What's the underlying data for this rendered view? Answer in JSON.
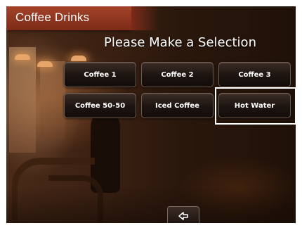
{
  "header": {
    "title": "Coffee Drinks"
  },
  "main": {
    "heading": "Please Make a Selection",
    "buttons": [
      {
        "label": "Coffee 1"
      },
      {
        "label": "Coffee 2"
      },
      {
        "label": "Coffee 3"
      },
      {
        "label": "Coffee 50-50"
      },
      {
        "label": "Iced Coffee"
      },
      {
        "label": "Hot Water",
        "highlighted": true
      }
    ]
  },
  "footer": {
    "back_icon": "back-arrow-icon"
  },
  "colors": {
    "title_bar": "#8e3520",
    "button_border": "#6e5a4e",
    "highlight": "#ffffff"
  }
}
